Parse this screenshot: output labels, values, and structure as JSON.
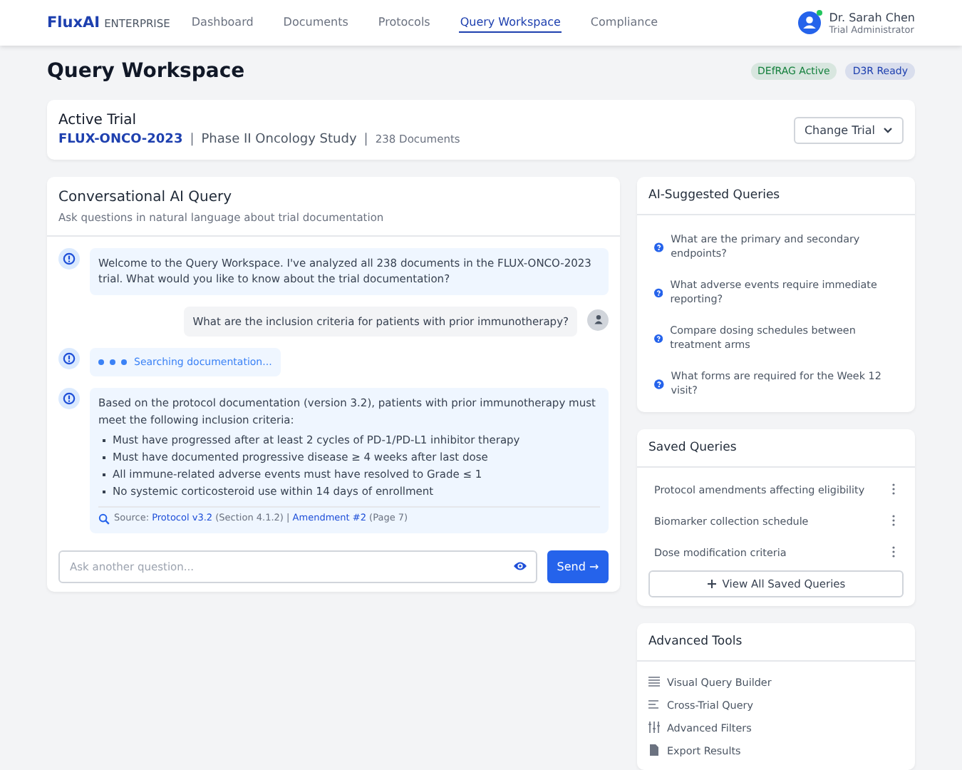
{
  "header": {
    "brand": "FluxAI",
    "edition": "ENTERPRISE",
    "nav": [
      {
        "label": "Dashboard",
        "selected": false
      },
      {
        "label": "Documents",
        "selected": false
      },
      {
        "label": "Protocols",
        "selected": false
      },
      {
        "label": "Query Workspace",
        "selected": true
      },
      {
        "label": "Compliance",
        "selected": false
      }
    ],
    "user": {
      "name": "Dr. Sarah Chen",
      "role": "Trial Administrator",
      "online": true
    }
  },
  "page": {
    "title": "Query Workspace",
    "badges": [
      {
        "label": "DEfRAG Active",
        "color": "#15803d"
      },
      {
        "label": "D3R Ready",
        "color": "#1e40af"
      }
    ]
  },
  "trial": {
    "title": "Active Trial",
    "id": "FLUX-ONCO-2023",
    "name": "Phase II Oncology Study",
    "documents": "238 Documents",
    "separator": "|",
    "button": "Change Trial"
  },
  "chat": {
    "title": "Conversational AI Query",
    "subtitle": "Ask questions in natural language about trial documentation",
    "messages": [
      {
        "kind": "ai",
        "text": "Welcome to the Query Workspace. I've analyzed all 238 documents in the FLUX-ONCO-2023 trial. What would you like to know about the trial documentation?"
      },
      {
        "kind": "user",
        "text": "What are the inclusion criteria for patients with prior immunotherapy?"
      },
      {
        "kind": "searching",
        "text": "Searching documentation..."
      },
      {
        "kind": "answer",
        "text": "Based on the protocol documentation (version 3.2), patients with prior immunotherapy must meet the following inclusion criteria:",
        "bullets": [
          "Must have progressed after at least 2 cycles of PD-1/PD-L1 inhibitor therapy",
          "Must have documented progressive disease ≥ 4 weeks after last dose",
          "All immune-related adverse events must have resolved to Grade ≤ 1",
          "No systemic corticosteroid use within 14 days of enrollment"
        ],
        "source": {
          "label": "Source:",
          "parts": [
            {
              "kind": "link",
              "text": "Protocol v3.2"
            },
            {
              "kind": "text",
              "text": "(Section 4.1.2) |"
            },
            {
              "kind": "link",
              "text": "Amendment #2"
            },
            {
              "kind": "text",
              "text": "(Page 7)"
            }
          ]
        }
      }
    ],
    "input": {
      "placeholder": "Ask another question..."
    },
    "send": "Send →"
  },
  "suggested": {
    "title": "AI-Suggested Queries",
    "items": [
      "What are the primary and secondary endpoints?",
      "What adverse events require immediate reporting?",
      "Compare dosing schedules between treatment arms",
      "What forms are required for the Week 12 visit?"
    ]
  },
  "saved": {
    "title": "Saved Queries",
    "items": [
      "Protocol amendments affecting eligibility",
      "Biomarker collection schedule",
      "Dose modification criteria"
    ],
    "button": "View All Saved Queries"
  },
  "tools": {
    "title": "Advanced Tools",
    "items": [
      {
        "kind": "builder",
        "label": "Visual Query Builder"
      },
      {
        "kind": "cross",
        "label": "Cross-Trial Query"
      },
      {
        "kind": "filters",
        "label": "Advanced Filters"
      },
      {
        "kind": "export",
        "label": "Export Results"
      }
    ]
  }
}
